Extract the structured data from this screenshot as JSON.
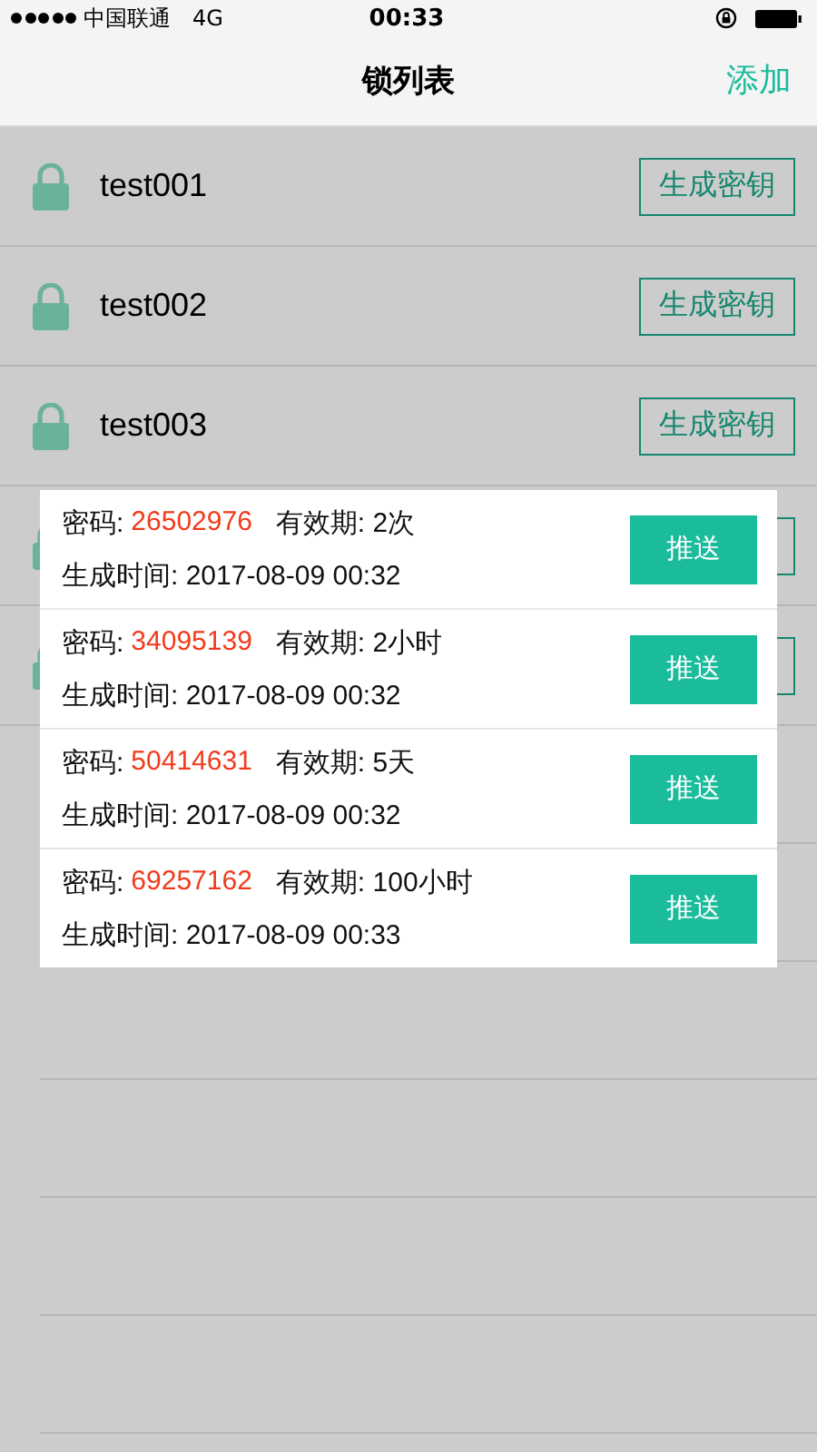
{
  "status_bar": {
    "carrier": "中国联通",
    "network": "4G",
    "time": "00:33"
  },
  "nav": {
    "title": "锁列表",
    "action": "添加"
  },
  "locks": [
    {
      "name": "test001",
      "button": "生成密钥"
    },
    {
      "name": "test002",
      "button": "生成密钥"
    },
    {
      "name": "test003",
      "button": "生成密钥"
    }
  ],
  "popup": {
    "keys": [
      {
        "label": "密码:",
        "code": "26502976",
        "validity": "有效期: 2次",
        "created": "生成时间: 2017-08-09 00:32",
        "button": "推送"
      },
      {
        "label": "密码:",
        "code": "34095139",
        "validity": "有效期: 2小时",
        "created": "生成时间: 2017-08-09 00:32",
        "button": "推送"
      },
      {
        "label": "密码:",
        "code": "50414631",
        "validity": "有效期: 5天",
        "created": "生成时间: 2017-08-09 00:32",
        "button": "推送"
      },
      {
        "label": "密码:",
        "code": "69257162",
        "validity": "有效期: 100小时",
        "created": "生成时间: 2017-08-09 00:33",
        "button": "推送"
      }
    ]
  }
}
